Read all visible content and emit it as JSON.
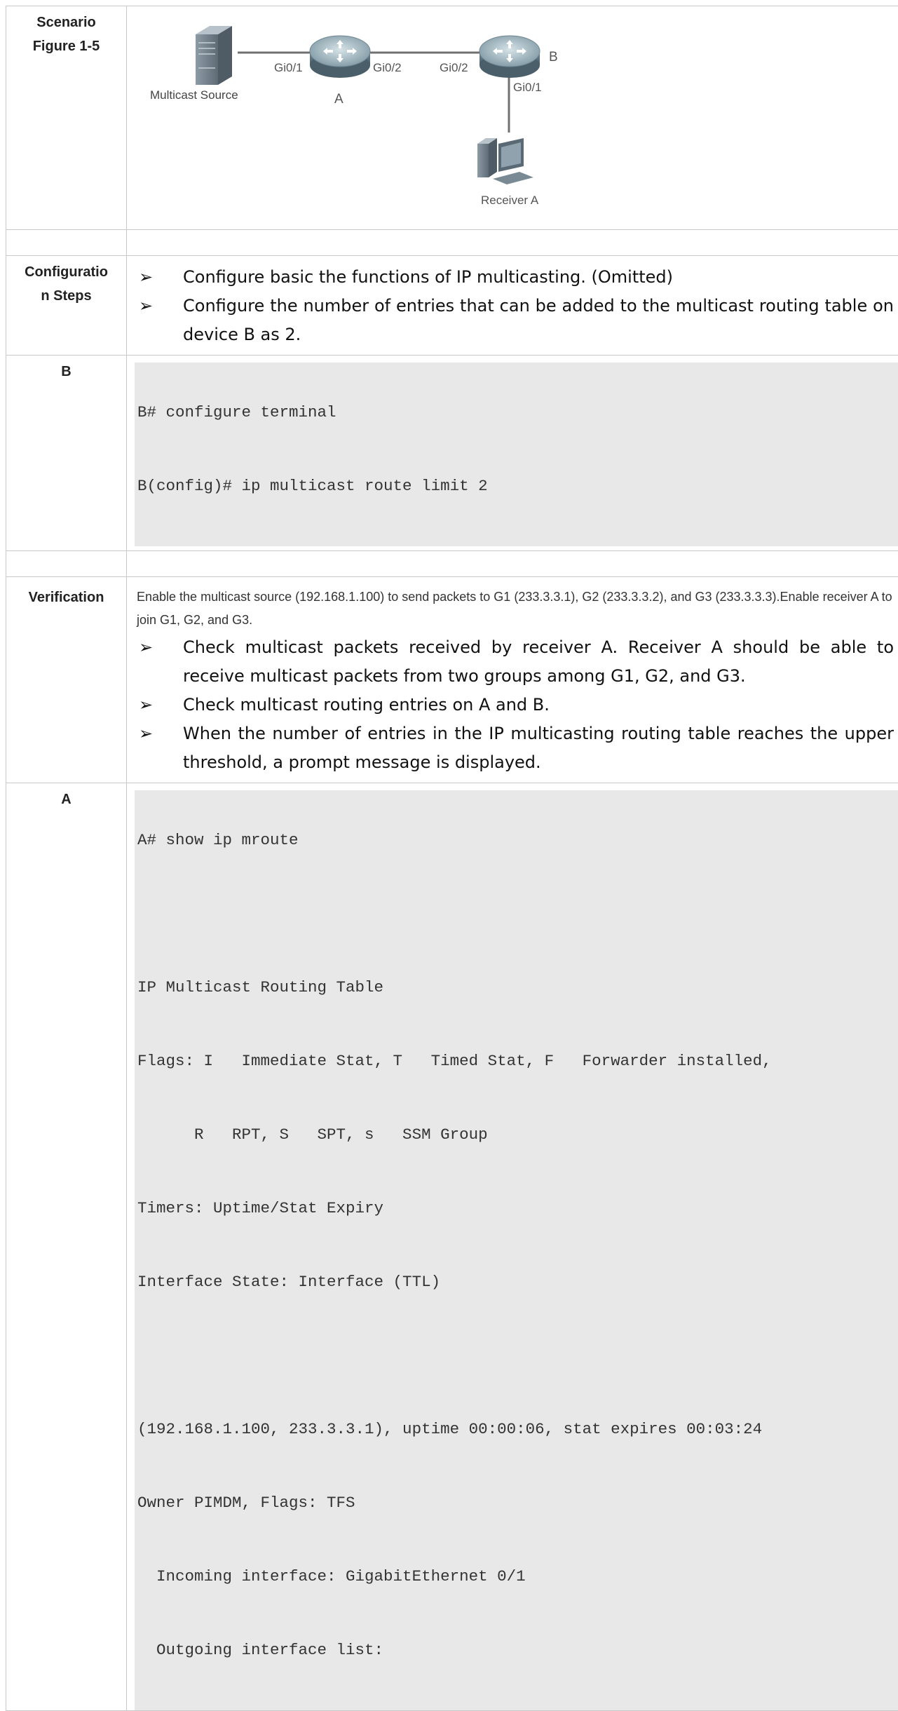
{
  "scenario": {
    "label_line1": "Scenario",
    "label_line2": "Figure 1-5",
    "diagram": {
      "source_label": "Multicast Source",
      "router_a_label": "A",
      "router_b_label": "B",
      "a_port_left": "Gi0/1",
      "a_port_right": "Gi0/2",
      "b_port_left": "Gi0/2",
      "b_port_down": "Gi0/1",
      "receiver_label": "Receiver A"
    }
  },
  "config_steps": {
    "label_line1": "Configuratio",
    "label_line2": "n Steps",
    "items": [
      "Configure basic the functions of IP multicasting. (Omitted)",
      "Configure the number of entries that can be added to the multicast routing table on device B as 2."
    ]
  },
  "device_b": {
    "label": "B",
    "code": [
      "B# configure terminal",
      "B(config)# ip multicast route limit 2"
    ]
  },
  "verification": {
    "label": "Verification",
    "intro": "Enable the multicast source (192.168.1.100) to send packets to G1 (233.3.3.1), G2 (233.3.3.2), and G3 (233.3.3.3).Enable receiver A to join G1, G2, and G3.",
    "items": [
      "Check multicast packets received by receiver A. Receiver A should be able to receive multicast packets from two groups among G1, G2, and G3.",
      "Check multicast routing entries on A and B.",
      "When the number of entries in the IP multicasting routing table reaches the upper threshold, a prompt message is displayed."
    ]
  },
  "device_a": {
    "label": "A",
    "code": [
      "A# show ip mroute",
      "",
      "IP Multicast Routing Table",
      "Flags: I   Immediate Stat, T   Timed Stat, F   Forwarder installed,",
      "      R   RPT, S   SPT, s   SSM Group",
      "Timers: Uptime/Stat Expiry",
      "Interface State: Interface (TTL)",
      "",
      "(192.168.1.100, 233.3.3.1), uptime 00:00:06, stat expires 00:03:24",
      "Owner PIMDM, Flags: TFS",
      "  Incoming interface: GigabitEthernet 0/1",
      "  Outgoing interface list:"
    ]
  },
  "bullet_glyph": "➢"
}
